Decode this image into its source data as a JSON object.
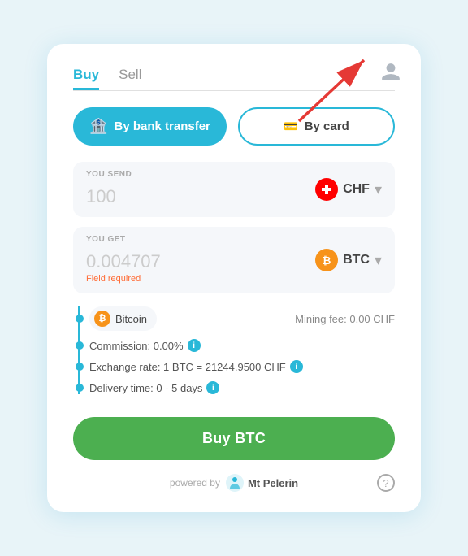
{
  "tabs": {
    "buy": "Buy",
    "sell": "Sell",
    "active": "buy"
  },
  "payment": {
    "bank_transfer": "By bank transfer",
    "by_card": "By card"
  },
  "send": {
    "label": "YOU SEND",
    "value": "100",
    "currency": "CHF",
    "currency_flag": "🇨🇭"
  },
  "get": {
    "label": "YOU GET",
    "value": "0.004707",
    "currency": "BTC",
    "field_required": "Field required"
  },
  "bitcoin_tag": "Bitcoin",
  "mining_fee": "Mining fee: 0.00 CHF",
  "commission": "Commission: 0.00%",
  "exchange_rate": "Exchange rate: 1 BTC = 21244.9500 CHF",
  "delivery_time": "Delivery time: 0 - 5 days",
  "buy_button": "Buy BTC",
  "footer": {
    "powered_by": "powered by",
    "brand": "Mt\nPelerin"
  }
}
